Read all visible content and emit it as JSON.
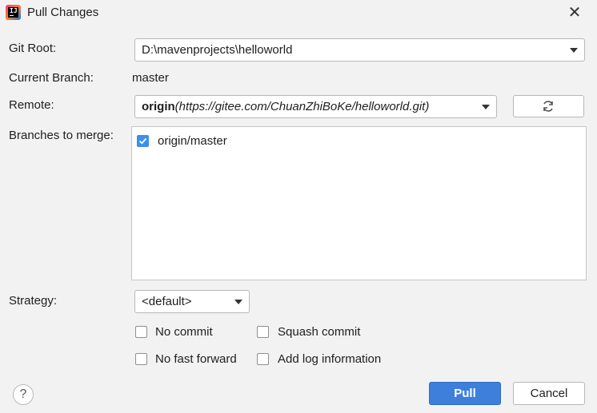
{
  "window": {
    "title": "Pull Changes",
    "app_icon": "intellij-app-icon",
    "close_icon": "close-icon"
  },
  "form": {
    "git_root_label": "Git Root:",
    "git_root_value": "D:\\mavenprojects\\helloworld",
    "current_branch_label": "Current Branch:",
    "current_branch_value": "master",
    "remote_label": "Remote:",
    "remote_name": "origin",
    "remote_url": "(https://gitee.com/ChuanZhiBoKe/helloworld.git)",
    "refresh_icon": "refresh-icon",
    "branches_label": "Branches to merge:",
    "branches": [
      {
        "label": "origin/master",
        "checked": true
      }
    ],
    "strategy_label": "Strategy:",
    "strategy_value": "<default>",
    "options": {
      "no_commit": {
        "label": "No commit",
        "checked": false
      },
      "squash_commit": {
        "label": "Squash commit",
        "checked": false
      },
      "no_fast_forward": {
        "label": "No fast forward",
        "checked": false
      },
      "add_log_information": {
        "label": "Add log information",
        "checked": false
      }
    }
  },
  "footer": {
    "help_label": "?",
    "pull_label": "Pull",
    "cancel_label": "Cancel"
  },
  "colors": {
    "accent": "#3d7fdb",
    "checkbox_checked": "#3a8ff0",
    "background": "#f2f2f2"
  }
}
